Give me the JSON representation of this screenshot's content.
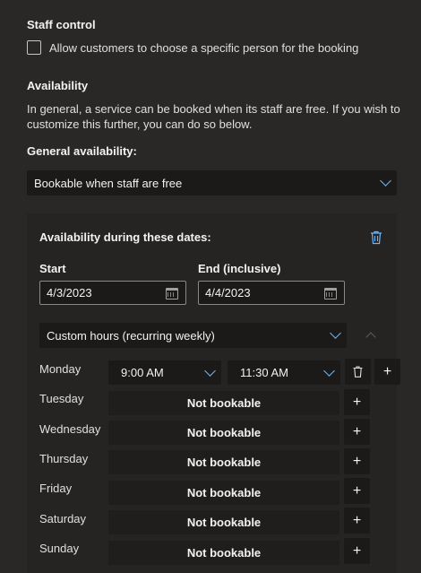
{
  "staff": {
    "heading": "Staff control",
    "checkbox_label": "Allow customers to choose a specific person for the booking"
  },
  "availability": {
    "heading": "Availability",
    "description_line1": "In general, a service can be booked when its staff are free. If you wish to",
    "description_line2": "customize this further, you can do so below.",
    "general_label": "General availability:",
    "general_value": "Bookable when staff are free"
  },
  "dates_panel": {
    "heading": "Availability during these dates:",
    "start_label": "Start",
    "start_value": "4/3/2023",
    "end_label": "End (inclusive)",
    "end_value": "4/4/2023",
    "hours_mode": "Custom hours (recurring weekly)"
  },
  "days": [
    {
      "name": "Monday",
      "start": "9:00 AM",
      "end": "11:30 AM"
    },
    {
      "name": "Tuesday",
      "status": "Not bookable"
    },
    {
      "name": "Wednesday",
      "status": "Not bookable"
    },
    {
      "name": "Thursday",
      "status": "Not bookable"
    },
    {
      "name": "Friday",
      "status": "Not bookable"
    },
    {
      "name": "Saturday",
      "status": "Not bookable"
    },
    {
      "name": "Sunday",
      "status": "Not bookable"
    }
  ],
  "icons": {
    "add": "+",
    "accent": "#6cb8f6"
  }
}
